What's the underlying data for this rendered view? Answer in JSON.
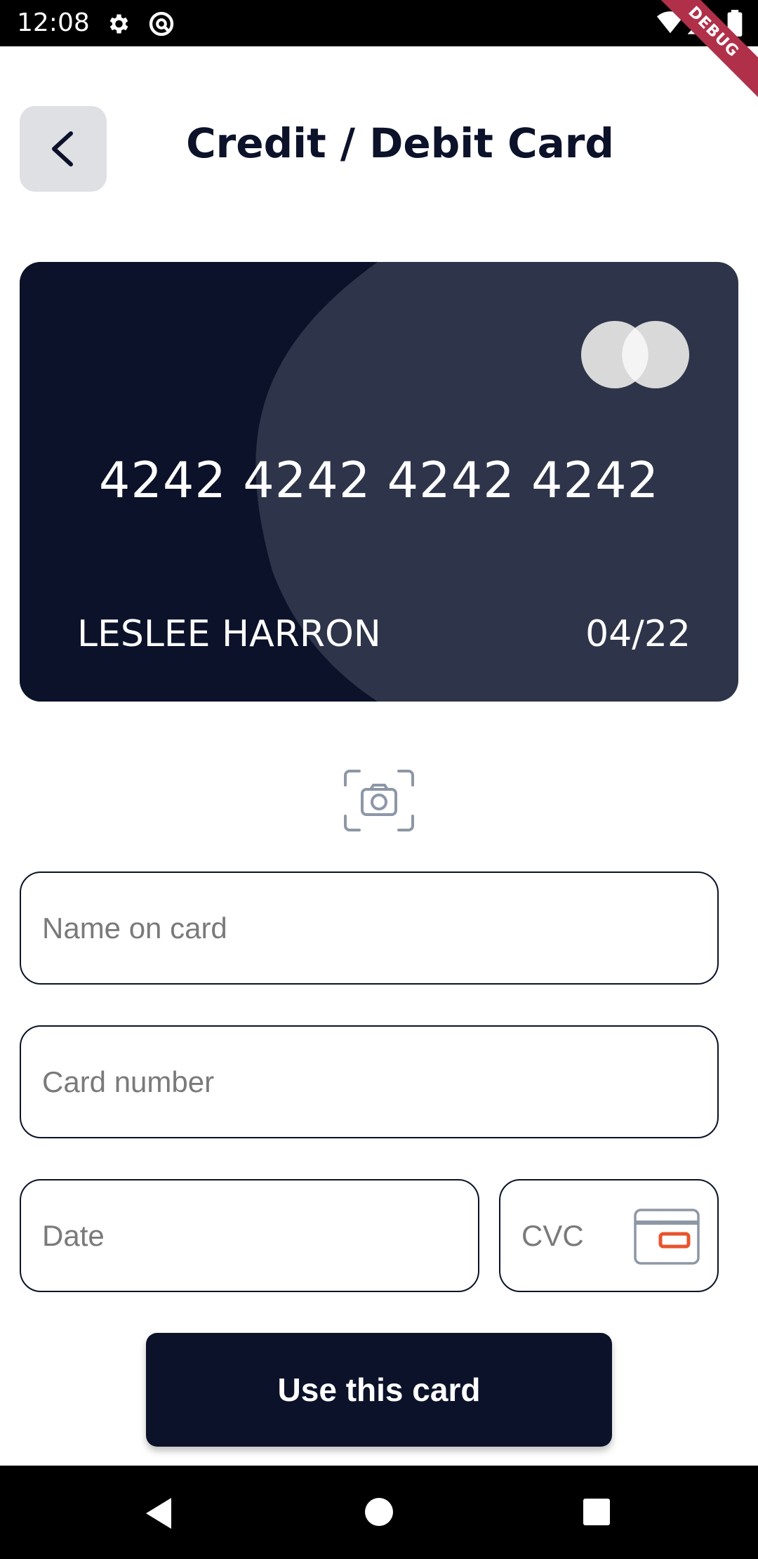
{
  "status_bar": {
    "time": "12:08",
    "icons": [
      "gear-icon",
      "sync-icon",
      "wifi-icon",
      "signal-icon",
      "battery-icon"
    ]
  },
  "debug_banner": "DEBUG",
  "header": {
    "back_icon": "chevron-left-icon",
    "title": "Credit / Debit Card"
  },
  "card": {
    "number": "4242 4242 4242 4242",
    "holder": "LESLEE HARRON",
    "expiry": "04/22",
    "brand_icon": "mastercard-logo-icon",
    "colors": {
      "dark": "#0b1229",
      "light": "#2e3449"
    }
  },
  "scan": {
    "icon": "camera-scan-icon"
  },
  "form": {
    "name_placeholder": "Name on card",
    "number_placeholder": "Card number",
    "date_placeholder": "Date",
    "cvc_placeholder": "CVC",
    "cvc_icon": "card-back-icon"
  },
  "submit_label": "Use this card",
  "nav_bar": {
    "icons": [
      "nav-back-icon",
      "nav-home-icon",
      "nav-recents-icon"
    ]
  },
  "colors": {
    "primary": "#0b1229",
    "accent": "#e8542c",
    "border": "#0b1229"
  }
}
